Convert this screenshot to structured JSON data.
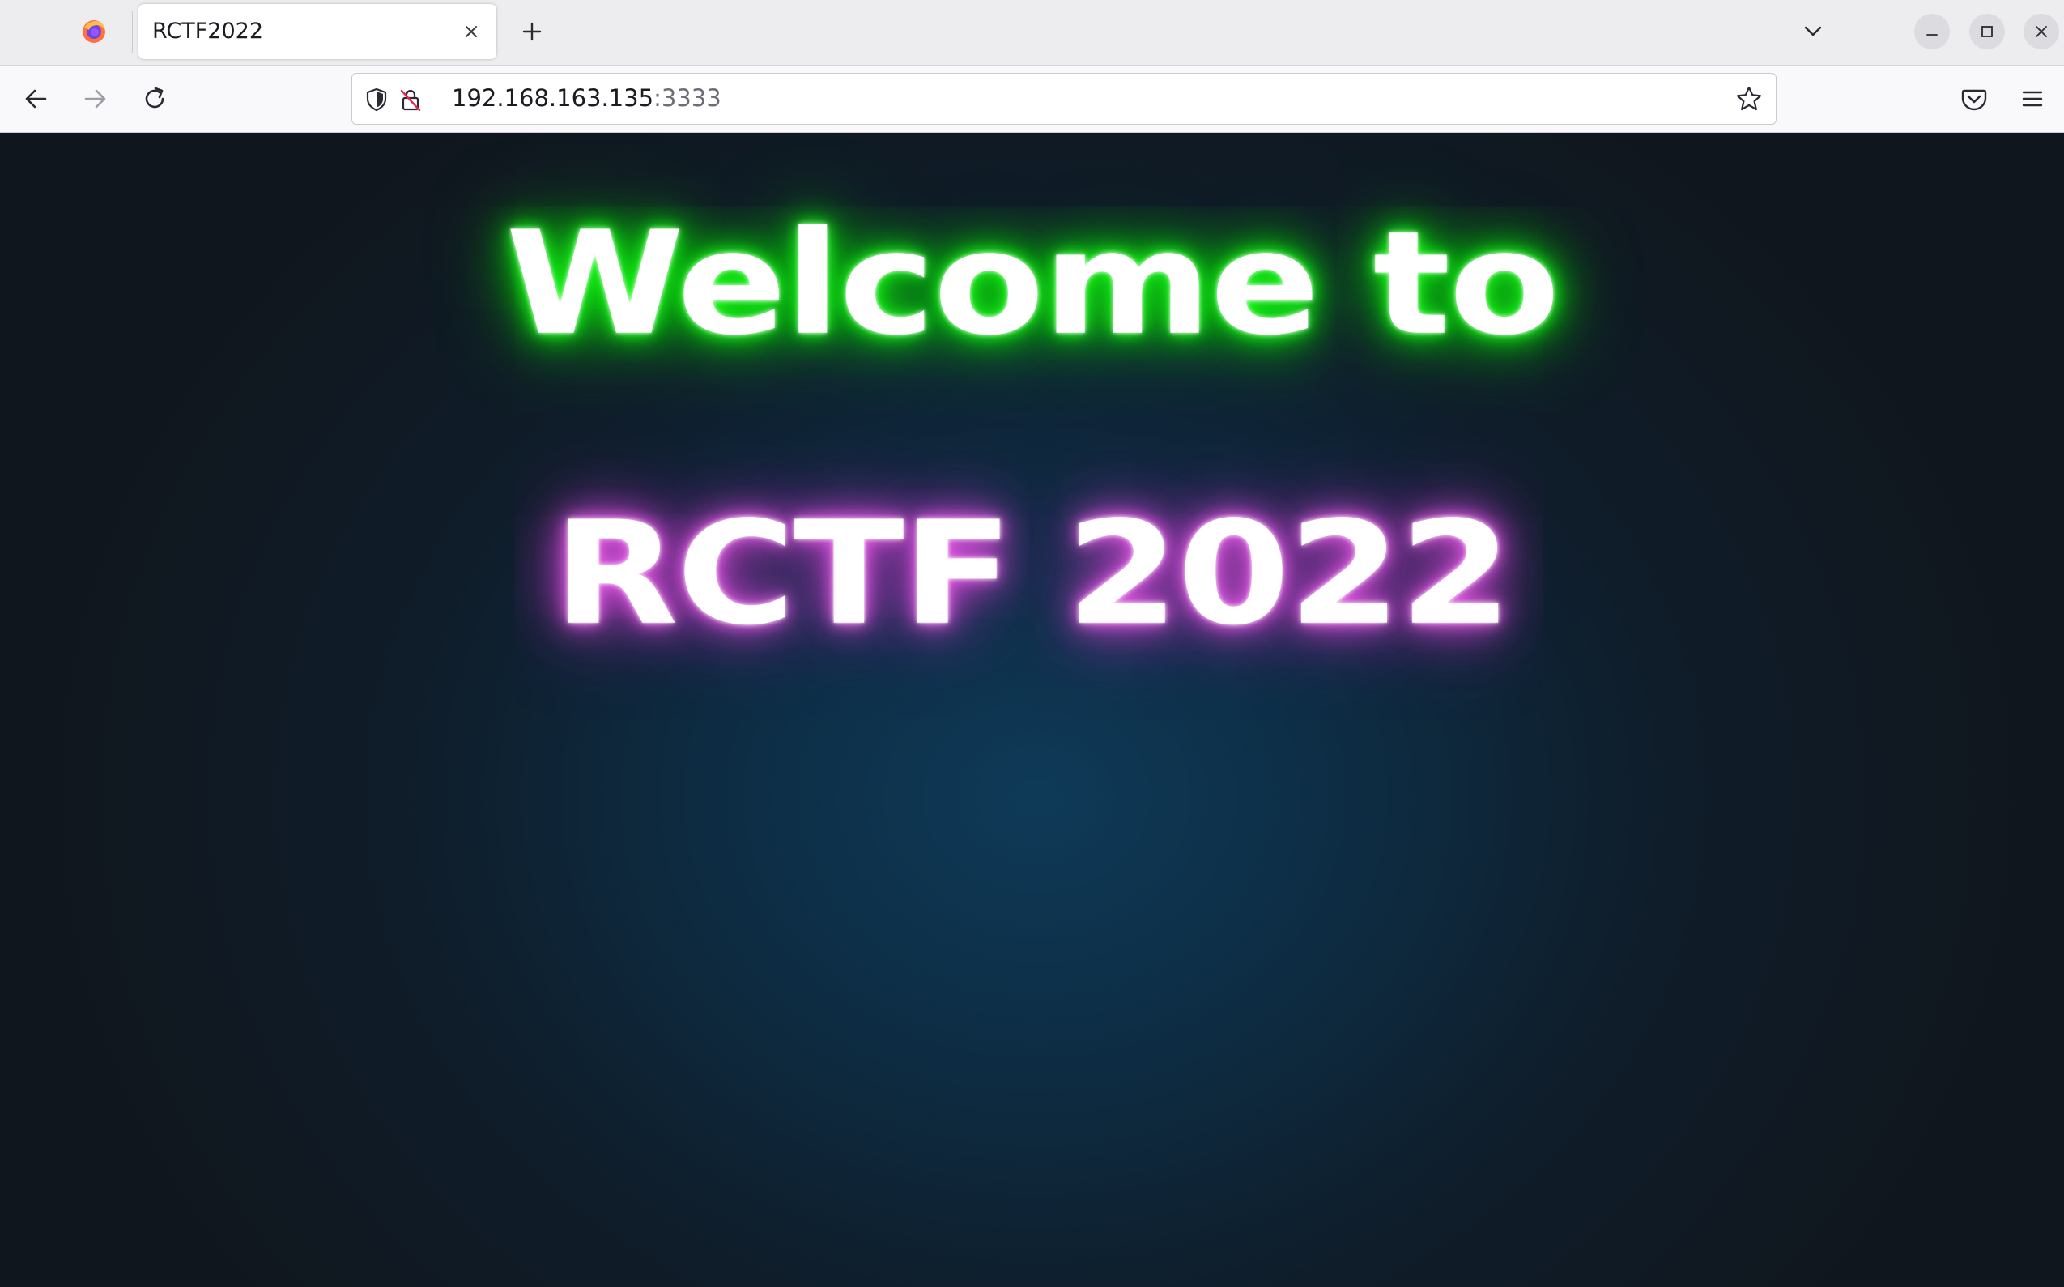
{
  "browser": {
    "tab": {
      "title": "RCTF2022"
    },
    "address_bar": {
      "host": "192.168.163.135",
      "port": ":3333"
    },
    "icons": {
      "app": "firefox-icon",
      "tab_close": "close-icon",
      "new_tab": "plus-icon",
      "tab_list": "chevron-down-icon",
      "back": "arrow-left-icon",
      "forward": "arrow-right-icon",
      "reload": "reload-icon",
      "tracking_protection": "shield-icon",
      "insecure_connection": "lock-strike-icon",
      "bookmark": "star-icon",
      "pocket": "pocket-icon",
      "menu": "hamburger-icon",
      "minimize": "minimize-icon",
      "maximize": "maximize-icon",
      "close_window": "close-icon"
    }
  },
  "page": {
    "line1": "Welcome to",
    "line2": "RCTF 2022",
    "colors": {
      "line1_glow": "#12ee12",
      "line2_glow": "#d54fd8",
      "background_center": "#0e3a58",
      "background_edge": "#10161d"
    }
  }
}
